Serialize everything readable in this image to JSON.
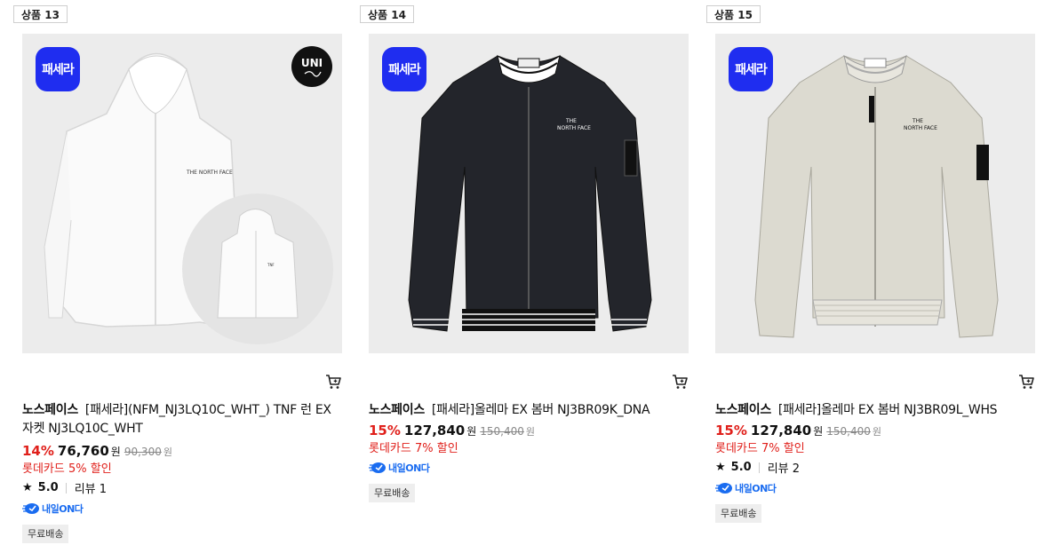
{
  "products": [
    {
      "number_label": "상품 13",
      "badge": "패세라",
      "uni_logo": "UNI",
      "brand": "노스페이스",
      "name": "[패세라](NFM_NJ3LQ10C_WHT_) TNF 런 EX 자켓 NJ3LQ10C_WHT",
      "discount": "14%",
      "price": "76,760",
      "currency": "원",
      "original_price": "90,300",
      "card_promo": "롯데카드 5% 할인",
      "rating": "5.0",
      "review": "리뷰 1",
      "delivery": "내일ON다",
      "free_shipping": "무료배송",
      "color": "#f3f3f3"
    },
    {
      "number_label": "상품 14",
      "badge": "패세라",
      "brand": "노스페이스",
      "name": "[패세라]올레마 EX 봄버 NJ3BR09K_DNA",
      "discount": "15%",
      "price": "127,840",
      "currency": "원",
      "original_price": "150,400",
      "card_promo": "롯데카드 7% 할인",
      "delivery": "내일ON다",
      "free_shipping": "무료배송",
      "color": "#23252b"
    },
    {
      "number_label": "상품 15",
      "badge": "패세라",
      "brand": "노스페이스",
      "name": "[패세라]올레마 EX 봄버 NJ3BR09L_WHS",
      "discount": "15%",
      "price": "127,840",
      "currency": "원",
      "original_price": "150,400",
      "card_promo": "롯데카드 7% 할인",
      "rating": "5.0",
      "review": "리뷰 2",
      "delivery": "내일ON다",
      "free_shipping": "무료배송",
      "color": "#dcdad0"
    }
  ],
  "icons": {
    "cart": "cart-icon",
    "star": "star-icon",
    "delivery": "rocket-icon"
  },
  "colors": {
    "badge_blue": "#1f2df0",
    "discount_red": "#e0201b",
    "delivery_blue": "#1a6cf0"
  }
}
